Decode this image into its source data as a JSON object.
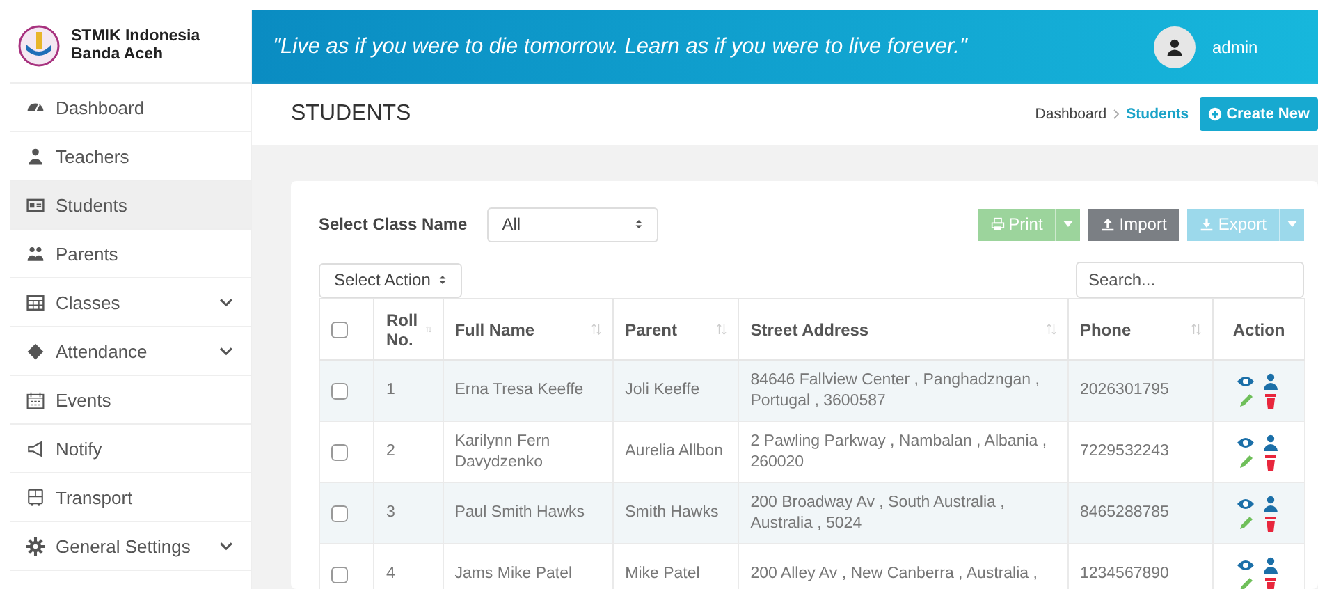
{
  "sidebar": {
    "brand": {
      "line1": "STMIK Indonesia",
      "line2": "Banda Aceh"
    },
    "items": [
      {
        "label": "Dashboard",
        "selected": false,
        "expandable": false
      },
      {
        "label": "Teachers",
        "selected": false,
        "expandable": false
      },
      {
        "label": "Students",
        "selected": true,
        "expandable": false
      },
      {
        "label": "Parents",
        "selected": false,
        "expandable": false
      },
      {
        "label": "Classes",
        "selected": false,
        "expandable": true
      },
      {
        "label": "Attendance",
        "selected": false,
        "expandable": true
      },
      {
        "label": "Events",
        "selected": false,
        "expandable": false
      },
      {
        "label": "Notify",
        "selected": false,
        "expandable": false
      },
      {
        "label": "Transport",
        "selected": false,
        "expandable": false
      },
      {
        "label": "General Settings",
        "selected": false,
        "expandable": true
      }
    ]
  },
  "header": {
    "quote": "\"Live as if you were to die tomorrow. Learn as if you were to live forever.\"",
    "user": "admin"
  },
  "page": {
    "title": "STUDENTS",
    "breadcrumb": [
      {
        "label": "Dashboard",
        "selected": false
      },
      {
        "label": "Students",
        "selected": true
      }
    ],
    "create_button": "Create New"
  },
  "filters": {
    "class_label": "Select Class Name",
    "class_select": "All",
    "buttons": [
      {
        "label": "Print",
        "kind": "print",
        "disabled": true,
        "has_menu": true
      },
      {
        "label": "Import",
        "kind": "import",
        "disabled": false,
        "has_menu": false
      },
      {
        "label": "Export",
        "kind": "export",
        "disabled": true,
        "has_menu": true
      }
    ],
    "action_select": "Select Action",
    "search": {
      "placeholder": "Search..."
    }
  },
  "table": {
    "select_all": {
      "checked": false
    },
    "columns": [
      {
        "label": "Roll No.",
        "sortable": true
      },
      {
        "label": "Full Name",
        "sortable": true
      },
      {
        "label": "Parent",
        "sortable": true
      },
      {
        "label": "Street Address",
        "sortable": true
      },
      {
        "label": "Phone",
        "sortable": true
      },
      {
        "label": "Action",
        "sortable": false
      }
    ],
    "rows": [
      {
        "checked": false,
        "roll": "1",
        "name": "Erna Tresa Keeffe",
        "parent": "Joli Keeffe",
        "address": "84646 Fallview Center , Panghadzngan , Portugal , 3600587",
        "phone": "2026301795"
      },
      {
        "checked": false,
        "roll": "2",
        "name": "Karilynn Fern Davydzenko",
        "parent": "Aurelia Allbon",
        "address": "2 Pawling Parkway , Nambalan , Albania , 260020",
        "phone": "7229532243"
      },
      {
        "checked": false,
        "roll": "3",
        "name": "Paul Smith Hawks",
        "parent": "Smith Hawks",
        "address": "200 Broadway Av , South Australia , Australia , 5024",
        "phone": "8465288785"
      },
      {
        "checked": false,
        "roll": "4",
        "name": "Jams Mike Patel",
        "parent": "Mike Patel",
        "address": "200 Alley Av , New Canberra , Australia ,",
        "phone": "1234567890"
      }
    ]
  }
}
